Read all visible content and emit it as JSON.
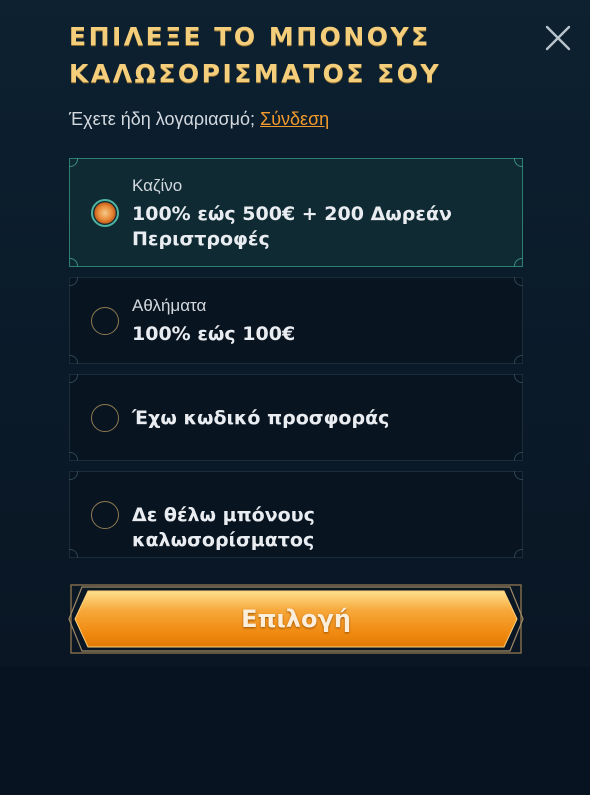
{
  "modal": {
    "title_line1": "ΕΠΙΛΕΞΕ ΤΟ ΜΠΟΝΟΥΣ",
    "title_line2": "ΚΑΛΩΣΟΡΙΣΜΑΤΟΣ ΣΟΥ",
    "close_icon": "close-icon"
  },
  "login": {
    "prompt": "Έχετε ήδη λογαριασμό; ",
    "link": "Σύνδεση"
  },
  "options": [
    {
      "label": "Καζίνο",
      "value": "100% εώς 500€ + 200 Δωρεάν Περιστροφές",
      "selected": true
    },
    {
      "label": "Αθλήματα",
      "value": "100% εώς 100€",
      "selected": false
    },
    {
      "label": "",
      "value": "Έχω κωδικό προσφοράς",
      "selected": false
    },
    {
      "label": "",
      "value": "Δε θέλω μπόνους καλωσορίσματος",
      "selected": false
    }
  ],
  "cta": {
    "label": "Επιλογή"
  },
  "colors": {
    "title_gold": "#f4ce7a",
    "link_orange": "#f39a2c",
    "selected_border": "#2f7d70",
    "cta_orange": "#f39a1c"
  }
}
